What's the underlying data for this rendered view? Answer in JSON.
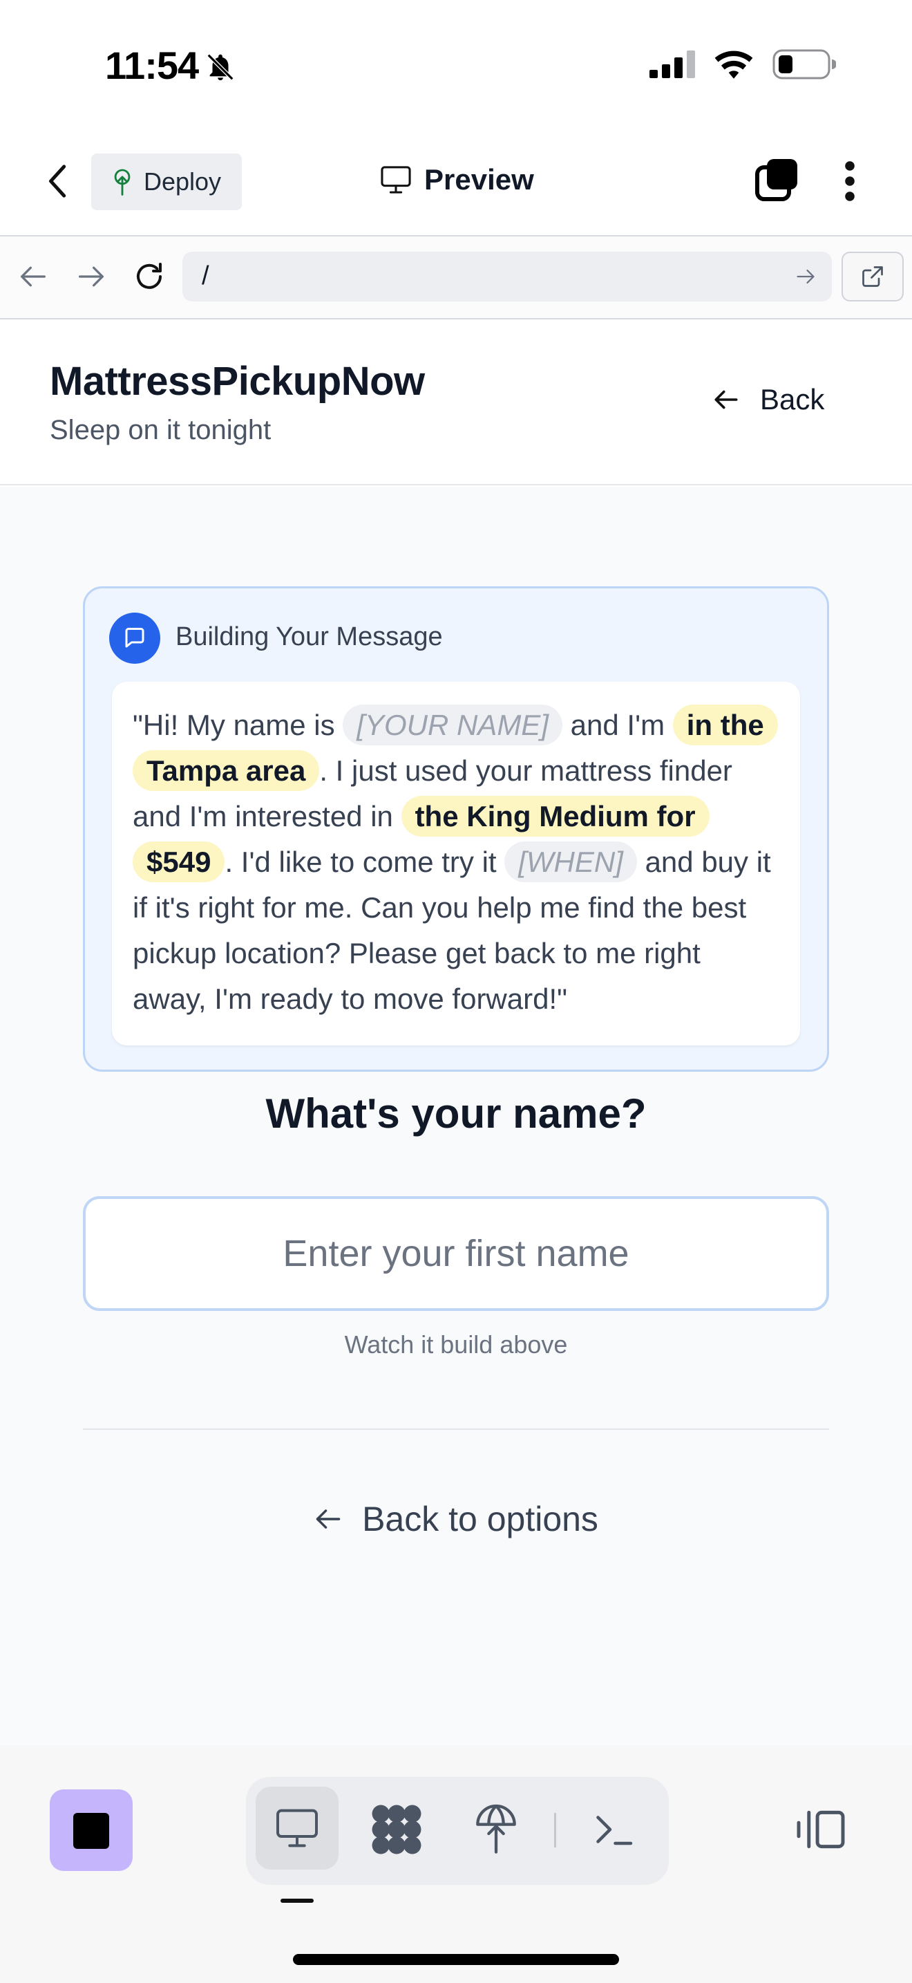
{
  "status_bar": {
    "time": "11:54"
  },
  "app_header": {
    "deploy_label": "Deploy",
    "preview_label": "Preview"
  },
  "browser": {
    "url": "/"
  },
  "site": {
    "brand": "MattressPickupNow",
    "tagline": "Sleep on it tonight",
    "back_label": "Back"
  },
  "message_card": {
    "title": "Building Your Message",
    "parts": {
      "t1": "\"Hi! My name is ",
      "ph_name": "[YOUR NAME]",
      "t2": " and I'm ",
      "hl_area": "in the Tampa area",
      "t3": ". I just used your mattress finder and I'm interested in ",
      "hl_product": "the King Medium for $549",
      "t4": ". I'd like to come try it ",
      "ph_when": "[WHEN]",
      "t5": " and buy it if it's right for me. Can you help me find the best pickup location? Please get back to me right away, I'm ready to move forward!\""
    }
  },
  "form": {
    "question": "What's your name?",
    "placeholder": "Enter your first name",
    "value": "",
    "hint": "Watch it build above"
  },
  "back_options_label": "Back to options",
  "colors": {
    "accent_blue": "#2563eb",
    "highlight": "#fdf6c3",
    "stop_purple": "#c4b5fd"
  },
  "icons": [
    "bell-slash-icon",
    "signal-icon",
    "wifi-icon",
    "battery-icon",
    "chevron-left-icon",
    "deploy-icon",
    "monitor-icon",
    "tabs-icon",
    "more-icon",
    "arrow-left-icon",
    "arrow-right-icon",
    "reload-icon",
    "open-external-icon",
    "chat-icon",
    "stop-icon",
    "grid-icon",
    "publish-icon",
    "terminal-icon",
    "panel-toggle-icon"
  ]
}
